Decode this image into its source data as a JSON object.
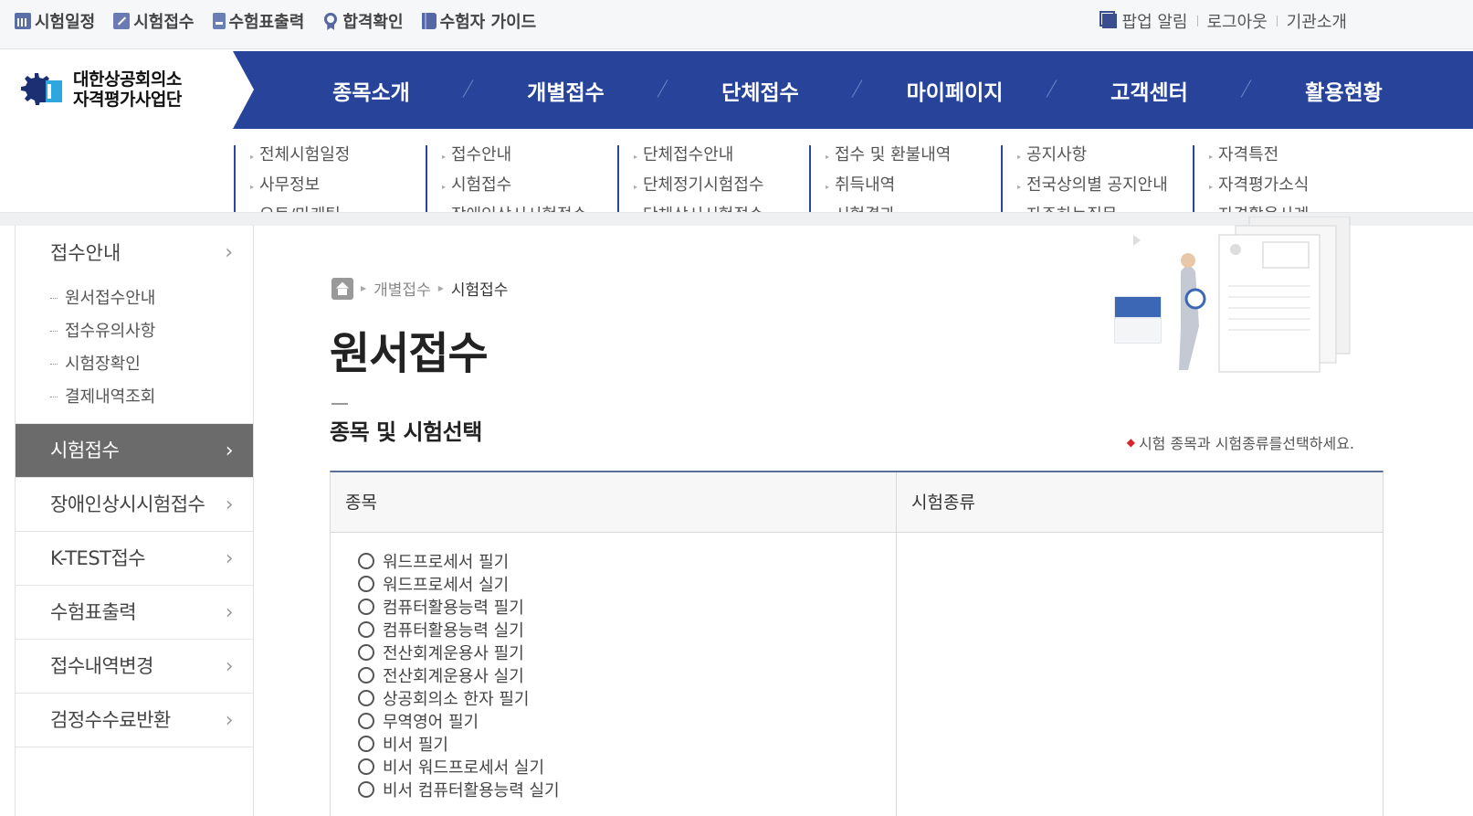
{
  "utility_left": [
    {
      "label": "시험일정",
      "icon": "calendar-icon"
    },
    {
      "label": "시험접수",
      "icon": "pen-icon"
    },
    {
      "label": "수험표출력",
      "icon": "card-icon"
    },
    {
      "label": "합격확인",
      "icon": "medal-icon"
    },
    {
      "label": "수험자 가이드",
      "icon": "book-icon"
    }
  ],
  "utility_right": {
    "popup": "팝업 알림",
    "logout": "로그아웃",
    "about": "기관소개"
  },
  "logo": {
    "line1": "대한상공회의소",
    "line2": "자격평가사업단"
  },
  "nav": [
    "종목소개",
    "개별접수",
    "단체접수",
    "마이페이지",
    "고객센터",
    "활용현황"
  ],
  "mega_menu": [
    [
      "전체시험일정",
      "사무정보",
      "오토/마케팅"
    ],
    [
      "접수안내",
      "시험접수",
      "장애인상시시험접수"
    ],
    [
      "단체접수안내",
      "단체정기시험접수",
      "단체상시시험접수"
    ],
    [
      "접수 및 환불내역",
      "취득내역",
      "시험결과"
    ],
    [
      "공지사항",
      "전국상의별 공지안내",
      "자주하는질문"
    ],
    [
      "자격특전",
      "자격평가소식",
      "자격활용사례"
    ]
  ],
  "sidebar": {
    "head": "접수안내",
    "subs": [
      "원서접수안내",
      "접수유의사항",
      "시험장확인",
      "결제내역조회"
    ],
    "items": [
      {
        "label": "시험접수",
        "active": true
      },
      {
        "label": "장애인상시시험접수",
        "active": false
      },
      {
        "label": "K-TEST접수",
        "active": false
      },
      {
        "label": "수험표출력",
        "active": false
      },
      {
        "label": "접수내역변경",
        "active": false
      },
      {
        "label": "검정수수료반환",
        "active": false
      }
    ]
  },
  "breadcrumb": {
    "level1": "개별접수",
    "level2": "시험접수"
  },
  "page_title": "원서접수",
  "section": {
    "title": "종목 및 시험선택",
    "note": "시험 종목과 시험종류를선택하세요."
  },
  "table": {
    "col1": "종목",
    "col2": "시험종류",
    "options": [
      "워드프로세서 필기",
      "워드프로세서 실기",
      "컴퓨터활용능력 필기",
      "컴퓨터활용능력 실기",
      "전산회계운용사 필기",
      "전산회계운용사 실기",
      "상공회의소 한자 필기",
      "무역영어 필기",
      "비서 필기",
      "비서 워드프로세서 실기",
      "비서 컴퓨터활용능력 실기"
    ]
  },
  "colors": {
    "nav_bg": "#27449a",
    "sidebar_active": "#6b6b6b",
    "note_red": "#d9262e"
  }
}
